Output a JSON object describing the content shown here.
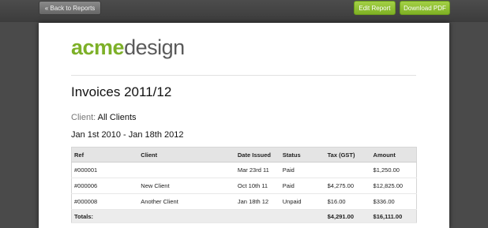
{
  "toolbar": {
    "back_label": "« Back to Reports",
    "edit_label": "Edit Report",
    "download_label": "Download PDF"
  },
  "logo": {
    "part1": "acme",
    "part2": "design"
  },
  "report": {
    "title": "Invoices 2011/12",
    "client_label": "Client:",
    "client_value": "All Clients",
    "date_range": "Jan 1st 2010 - Jan 18th 2012"
  },
  "table": {
    "headers": [
      "Ref",
      "Client",
      "Date Issued",
      "Status",
      "Tax (GST)",
      "Amount"
    ],
    "rows": [
      {
        "ref": "#000001",
        "client": "",
        "date": "Mar 23rd 11",
        "status": "Paid",
        "tax": "",
        "amount": "$1,250.00"
      },
      {
        "ref": "#000006",
        "client": "New Client",
        "date": "Oct 10th 11",
        "status": "Paid",
        "tax": "$4,275.00",
        "amount": "$12,825.00"
      },
      {
        "ref": "#000008",
        "client": "Another Client",
        "date": "Jan 18th 12",
        "status": "Unpaid",
        "tax": "$16.00",
        "amount": "$336.00"
      }
    ],
    "totals": {
      "label": "Totals:",
      "tax": "$4,291.00",
      "amount": "$16,111.00"
    }
  },
  "colors": {
    "accent_green": "#7db028",
    "paid_status": "#3f9a2a",
    "topbar": "#444444"
  }
}
